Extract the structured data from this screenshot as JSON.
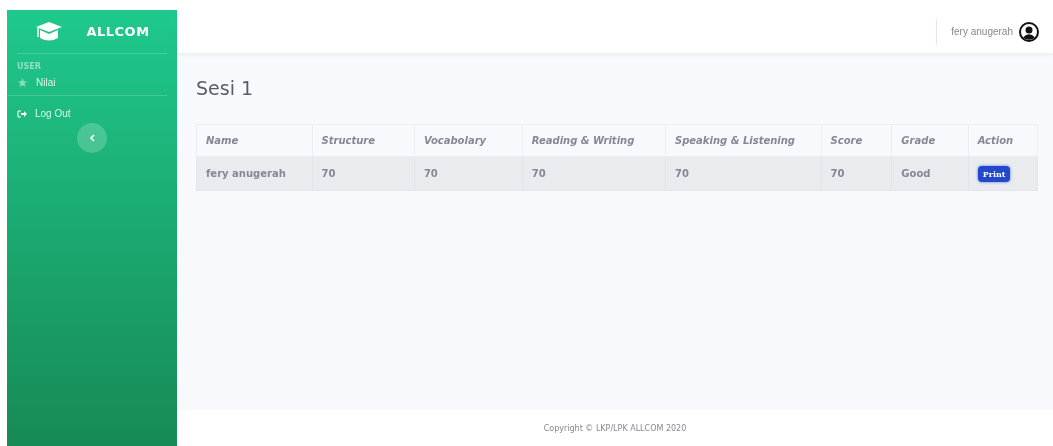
{
  "sidebar": {
    "brand": "ALLCOM",
    "section": "USER",
    "items": [
      {
        "label": "Nilai",
        "kind": "nav"
      },
      {
        "label": "Log Out",
        "kind": "logout"
      }
    ]
  },
  "topbar": {
    "user": "fery anugerah"
  },
  "page_title": "Sesi 1",
  "table": {
    "columns": [
      "Name",
      "Structure",
      "Vocabolary",
      "Reading & Writing",
      "Speaking & Listening",
      "Score",
      "Grade",
      "Action"
    ],
    "rows": [
      {
        "cells": [
          "fery anugerah",
          "70",
          "70",
          "70",
          "70",
          "70",
          "Good"
        ],
        "action": "Print"
      }
    ]
  },
  "footer": "Copyright © LKP/LPK ALLCOM 2020"
}
